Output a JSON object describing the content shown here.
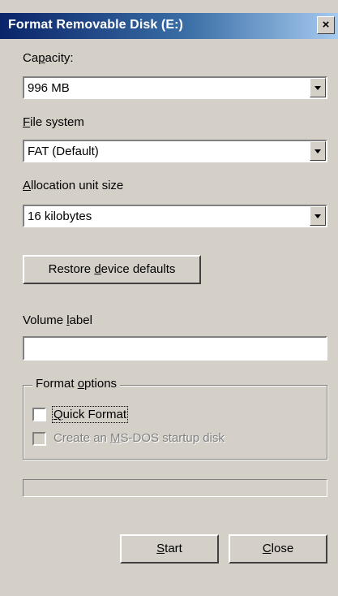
{
  "window": {
    "title": "Format Removable Disk (E:)",
    "close_symbol": "×"
  },
  "capacity": {
    "label_pre": "Ca",
    "label_key": "p",
    "label_post": "acity:",
    "value": "996 MB"
  },
  "file_system": {
    "label_key": "F",
    "label_post": "ile system",
    "value": "FAT (Default)"
  },
  "allocation": {
    "label_key": "A",
    "label_post": "llocation unit size",
    "value": "16 kilobytes"
  },
  "restore": {
    "pre": "Restore ",
    "key": "d",
    "post": "evice defaults"
  },
  "volume": {
    "label_pre": "Volume ",
    "label_key": "l",
    "label_post": "abel",
    "value": ""
  },
  "format_options": {
    "title_pre": "Format ",
    "title_key": "o",
    "title_post": "ptions",
    "quick_format": {
      "key": "Q",
      "post": "uick Format",
      "checked": false
    },
    "msdos_disk": {
      "pre": "Create an ",
      "key": "M",
      "post": "S-DOS startup disk",
      "checked": false,
      "enabled": false
    }
  },
  "progress": {
    "value": 0
  },
  "buttons": {
    "start": {
      "key": "S",
      "post": "tart"
    },
    "close": {
      "key": "C",
      "post": "lose"
    }
  }
}
